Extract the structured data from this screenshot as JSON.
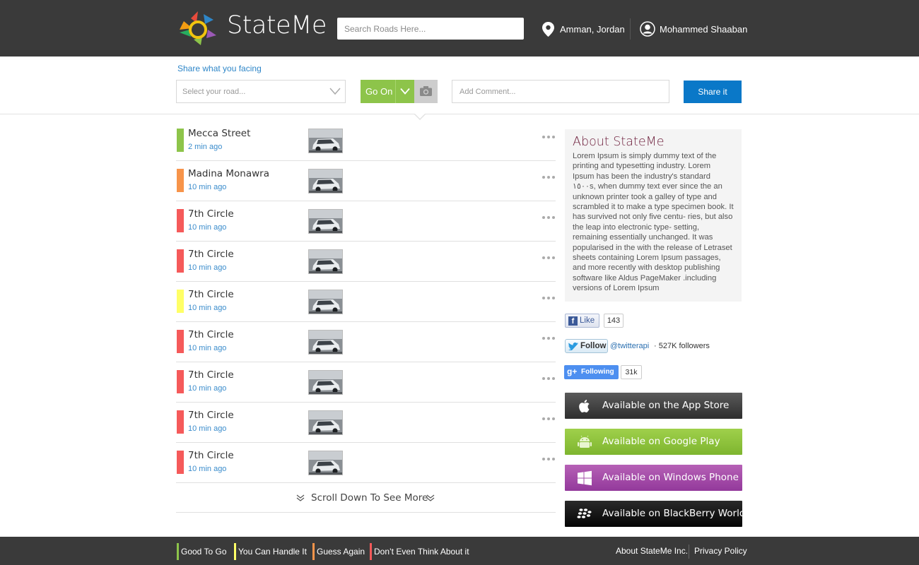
{
  "header": {
    "brand": "StateMe",
    "search_placeholder": "Search Roads Here...",
    "location": "Amman, Jordan",
    "user_name": "Mohammed Shaaban"
  },
  "share": {
    "label": "Share what you facing",
    "road_placeholder": "Select your road...",
    "status_label": "Go On",
    "comment_placeholder": "Add Comment...",
    "share_button": "Share it"
  },
  "colors": {
    "good": "#8dc44a",
    "handle": "#ffff66",
    "guess": "#f7944a",
    "dont": "#f55a5a",
    "accent_blue": "#0a78c8"
  },
  "feed": [
    {
      "name": "Mecca Street",
      "time": "2 min ago",
      "status": "good"
    },
    {
      "name": "Madina Monawra",
      "time": "10 min ago",
      "status": "guess"
    },
    {
      "name": "7th Circle",
      "time": "10 min ago",
      "status": "dont"
    },
    {
      "name": "7th Circle",
      "time": "10 min ago",
      "status": "dont"
    },
    {
      "name": "7th Circle",
      "time": "10 min ago",
      "status": "handle"
    },
    {
      "name": "7th Circle",
      "time": "10 min ago",
      "status": "dont"
    },
    {
      "name": "7th Circle",
      "time": "10 min ago",
      "status": "dont"
    },
    {
      "name": "7th Circle",
      "time": "10 min ago",
      "status": "dont"
    },
    {
      "name": "7th Circle",
      "time": "10 min ago",
      "status": "dont"
    }
  ],
  "scroll_more": "Scroll Down To See More",
  "about": {
    "title": "About StateMe",
    "body": "Lorem Ipsum is simply dummy text of the printing and typesetting industry. Lorem Ipsum has been the industry's standard ١٥٠٠s, when dummy text ever since the an unknown printer took a galley of type and scrambled it to make a type specimen book. It has survived not only five centu- ries, but also the leap into electronic type- setting, remaining essentially unchanged. It was popularised in the  with the release of Letraset sheets containing Lorem Ipsum passages, and more recently with desktop publishing software like Aldus PageMaker .including versions of Lorem Ipsum"
  },
  "social": {
    "fb_label": "Like",
    "fb_count": "143",
    "tw_label": "Follow",
    "tw_handle": "@twitterapi",
    "tw_followers": "· 527K followers",
    "gp_label": "Following",
    "gp_count": "31k"
  },
  "stores": {
    "apple": "Available on the App Store",
    "google": "Available on Google Play",
    "windows": "Available on Windows Phone",
    "blackberry": "Available on BlackBerry World"
  },
  "footer": {
    "legend": [
      "Good To Go",
      "You Can Handle It",
      "Guess Again",
      "Don’t Even Think  About it"
    ],
    "about_link": "About StateMe Inc.",
    "privacy_link": "Privacy Policy"
  }
}
